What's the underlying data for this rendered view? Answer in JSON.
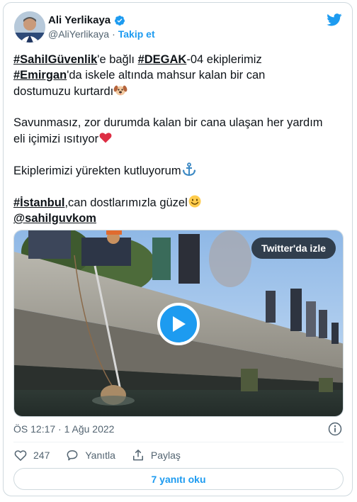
{
  "author": {
    "name": "Ali Yerlikaya",
    "handle": "@AliYerlikaya",
    "separator": "·",
    "follow_label": "Takip et"
  },
  "tweet": {
    "line1": {
      "tag1": "#SahilGüvenlik",
      "text1": "'e bağlı ",
      "tag2": "#DEGAK",
      "text2": "-04 ekiplerimiz"
    },
    "line2": {
      "tag3": "#Emirgan",
      "text3": "'da iskele altında mahsur kalan bir can"
    },
    "line3": {
      "text": "dostumuzu kurtardı"
    },
    "para2_line1": "Savunmasız, zor durumda kalan bir cana ulaşan her yardım",
    "para2_line2": "eli içimizi ısıtıyor",
    "para3": "Ekiplerimizi yürekten kutluyorum",
    "para4": {
      "tag4": "#İstanbul",
      "text4": ",can dostlarımızla güzel"
    },
    "mention": "@sahilguvkom"
  },
  "emojis": {
    "dog": "dog-face-icon",
    "heart": "red-heart-icon",
    "anchor": "anchor-icon",
    "smile": "smiling-face-icon"
  },
  "media": {
    "watch_label": "Twitter'da izle"
  },
  "meta": {
    "timestamp": "ÖS 12:17 · 1 Ağu 2022"
  },
  "actions": {
    "like_count": "247",
    "reply_label": "Yanıtla",
    "share_label": "Paylaş"
  },
  "replies_label": "7 yanıtı oku",
  "colors": {
    "accent": "#1d9bf0",
    "text": "#0f1419",
    "muted": "#536471",
    "border": "#cfd9de"
  }
}
